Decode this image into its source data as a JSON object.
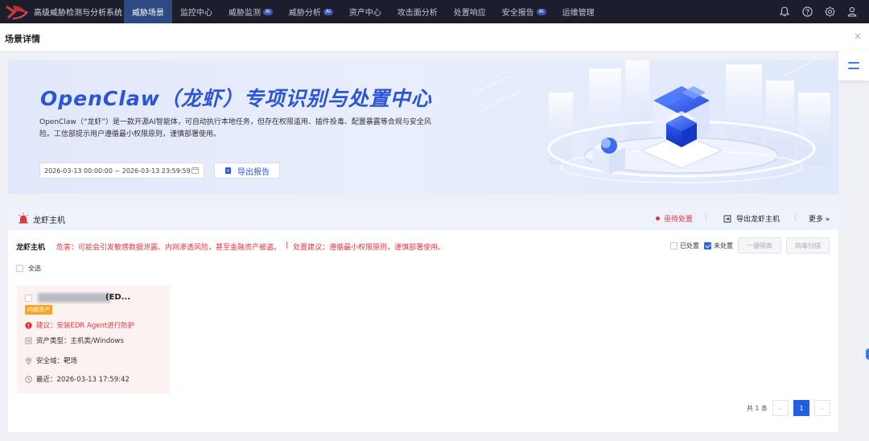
{
  "app": {
    "title": "高级威胁检测与分析系统"
  },
  "nav": {
    "items": [
      {
        "label": "威胁场景",
        "badge": "",
        "active": true
      },
      {
        "label": "监控中心",
        "badge": ""
      },
      {
        "label": "威胁监测",
        "badge": "AI"
      },
      {
        "label": "威胁分析",
        "badge": "AI"
      },
      {
        "label": "资产中心",
        "badge": ""
      },
      {
        "label": "攻击面分析",
        "badge": ""
      },
      {
        "label": "处置响应",
        "badge": ""
      },
      {
        "label": "安全报告",
        "badge": "AI"
      },
      {
        "label": "运维管理",
        "badge": ""
      }
    ],
    "icons": [
      "bell-icon",
      "help-icon",
      "gear-icon",
      "user-icon"
    ]
  },
  "page": {
    "title": "场景详情"
  },
  "banner": {
    "title": "OpenClaw（龙虾）专项识别与处置中心",
    "description": "OpenClaw（“龙虾”）是一款开源AI智能体，可自动执行本地任务，但存在权限滥用、插件投毒、配置暴露等合规与安全风险。工信部提示用户遵循最小权限原则，谨慎部署使用。",
    "date_range": "2026-03-13 00:00:00 ~ 2026-03-13 23:59:59",
    "export_label": "导出报告"
  },
  "card": {
    "title": "龙虾主机",
    "status": "亟待处置",
    "export_label": "导出龙虾主机",
    "more_label": "更多 »",
    "risk_label": "龙虾主机",
    "risk_text": "危害：可能会引发敏感数据泄露、内网渗透风险，甚至金融资产被盗。",
    "risk_pipe": "|",
    "advice_text": "处置建议：遵循最小权限原则，谨慎部署使用。",
    "filters": {
      "handled": "已处置",
      "unhandled": "未处置",
      "isolate": "一键隔离",
      "scan": "病毒扫描"
    },
    "select_all": "全选"
  },
  "host": {
    "name_suffix": "(ED...",
    "tag": "内部资产",
    "advice": "建议：安装EDR Agent进行防护",
    "asset_type": "资产类型：主机类/Windows",
    "security_domain": "安全域：靶场",
    "last_seen": "最近：2026-03-13 17:59:42"
  },
  "pager": {
    "total": "共 1 条",
    "prev": "‹",
    "current": "1",
    "next": "›"
  },
  "colors": {
    "nav_bg": "#1c1f2b",
    "nav_active": "#2e4a83",
    "accent": "#2a55d8",
    "danger": "#e0373e",
    "tag": "#f5a524"
  }
}
